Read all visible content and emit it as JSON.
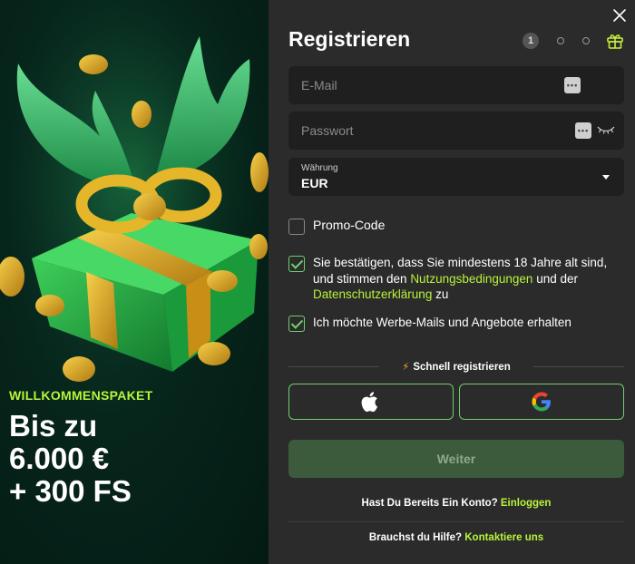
{
  "promo": {
    "eyebrow": "WILLKOMMENSPAKET",
    "headline_lines": [
      "Bis zu",
      "6.000 €",
      "+ 300 FS"
    ]
  },
  "form": {
    "title": "Registrieren",
    "step_number": "1",
    "email_placeholder": "E-Mail",
    "password_placeholder": "Passwort",
    "currency_label": "Währung",
    "currency_value": "EUR",
    "promo_code_label": "Promo-Code",
    "terms": {
      "text_before": "Sie bestätigen, dass Sie mindestens 18 Jahre alt sind, und stimmen den ",
      "terms_link": "Nutzungsbedingungen",
      "text_middle": " und der ",
      "privacy_link": "Datenschutzerklärung",
      "text_after": " zu"
    },
    "marketing_label": "Ich möchte Werbe-Mails und Angebote erhalten",
    "quick_register": "Schnell registrieren",
    "submit_label": "Weiter",
    "login_prompt": "Hast Du Bereits Ein Konto?",
    "login_link": "Einloggen",
    "help_prompt": "Brauchst du Hilfe?",
    "help_link": "Kontaktiere uns"
  },
  "checkboxes": {
    "promo_code": false,
    "terms": true,
    "marketing": true
  },
  "colors": {
    "accent_green": "#b8f53a",
    "check_green": "#6fcf6f",
    "panel": "#2b2b2b",
    "field": "#1f1f1f"
  },
  "icons": [
    "close-icon",
    "gift-icon",
    "dots-icon",
    "eye-closed-icon",
    "chevron-down-icon",
    "bolt-icon",
    "apple-icon",
    "google-icon"
  ]
}
